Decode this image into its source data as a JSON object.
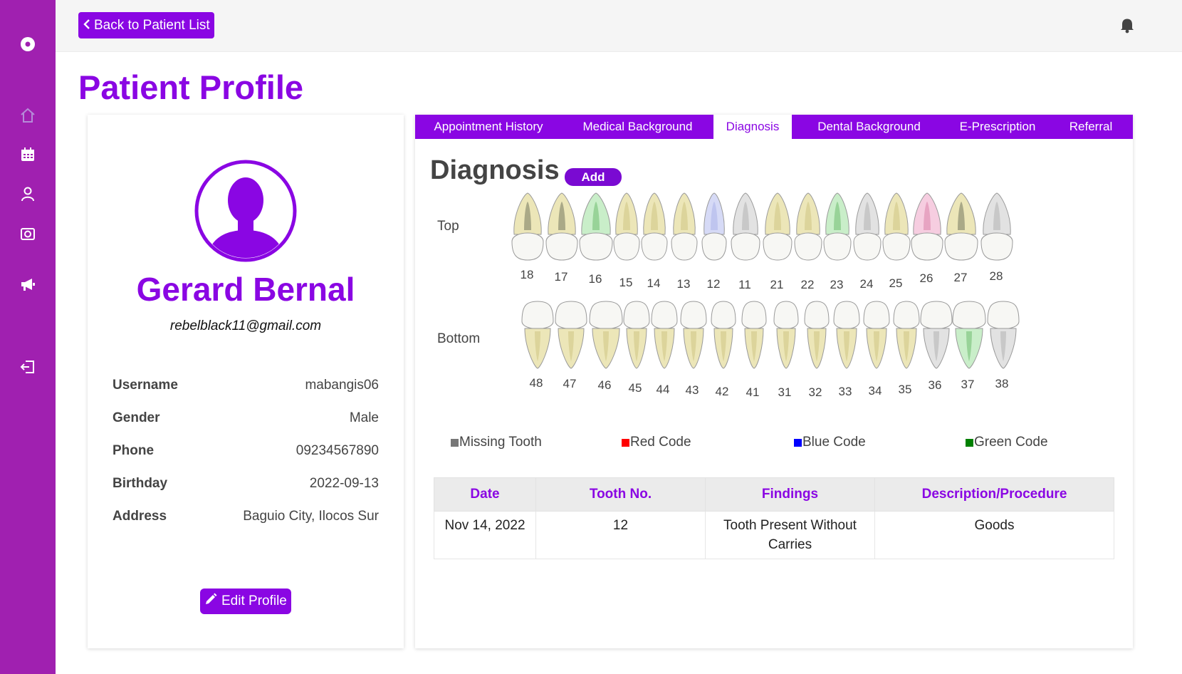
{
  "sidebar": {
    "items": [
      {
        "icon": "logo-icon"
      },
      {
        "icon": "home-icon"
      },
      {
        "icon": "calendar-icon"
      },
      {
        "icon": "user-icon"
      },
      {
        "icon": "camera-icon"
      },
      {
        "icon": "megaphone-icon"
      },
      {
        "icon": "logout-icon"
      }
    ]
  },
  "header": {
    "back_label": "Back to Patient List",
    "bell_icon": "bell-icon"
  },
  "page": {
    "title": "Patient Profile"
  },
  "profile": {
    "name": "Gerard Bernal",
    "email": "rebelblack11@gmail.com",
    "fields": [
      {
        "label": "Username",
        "value": "mabangis06"
      },
      {
        "label": "Gender",
        "value": "Male"
      },
      {
        "label": "Phone",
        "value": "09234567890"
      },
      {
        "label": "Birthday",
        "value": "2022-09-13"
      },
      {
        "label": "Address",
        "value": "Baguio City, Ilocos Sur"
      }
    ],
    "edit_label": "Edit Profile"
  },
  "tabs": [
    {
      "label": "Appointment History",
      "active": false
    },
    {
      "label": "Medical Background",
      "active": false
    },
    {
      "label": "Diagnosis",
      "active": true
    },
    {
      "label": "Dental Background",
      "active": false
    },
    {
      "label": "E-Prescription",
      "active": false
    },
    {
      "label": "Referral",
      "active": false
    }
  ],
  "diagnosis": {
    "title": "Diagnosis",
    "add_label": "Add",
    "top_label": "Top",
    "bottom_label": "Bottom",
    "top_teeth": [
      {
        "no": "18",
        "status": "caries"
      },
      {
        "no": "17",
        "status": "caries"
      },
      {
        "no": "16",
        "status": "green"
      },
      {
        "no": "15",
        "status": "present"
      },
      {
        "no": "14",
        "status": "present"
      },
      {
        "no": "13",
        "status": "present"
      },
      {
        "no": "12",
        "status": "blue"
      },
      {
        "no": "11",
        "status": "missing"
      },
      {
        "no": "21",
        "status": "present"
      },
      {
        "no": "22",
        "status": "present"
      },
      {
        "no": "23",
        "status": "green"
      },
      {
        "no": "24",
        "status": "missing"
      },
      {
        "no": "25",
        "status": "present"
      },
      {
        "no": "26",
        "status": "red"
      },
      {
        "no": "27",
        "status": "caries"
      },
      {
        "no": "28",
        "status": "missing"
      }
    ],
    "bottom_teeth": [
      {
        "no": "48",
        "status": "present"
      },
      {
        "no": "47",
        "status": "present"
      },
      {
        "no": "46",
        "status": "present"
      },
      {
        "no": "45",
        "status": "present"
      },
      {
        "no": "44",
        "status": "present"
      },
      {
        "no": "43",
        "status": "present"
      },
      {
        "no": "42",
        "status": "present"
      },
      {
        "no": "41",
        "status": "present"
      },
      {
        "no": "31",
        "status": "present"
      },
      {
        "no": "32",
        "status": "present"
      },
      {
        "no": "33",
        "status": "present"
      },
      {
        "no": "34",
        "status": "present"
      },
      {
        "no": "35",
        "status": "present"
      },
      {
        "no": "36",
        "status": "missing"
      },
      {
        "no": "37",
        "status": "green"
      },
      {
        "no": "38",
        "status": "missing"
      }
    ],
    "legend": [
      {
        "label": "Missing Tooth",
        "color": "#777777"
      },
      {
        "label": "Red Code",
        "color": "#ff0000"
      },
      {
        "label": "Blue Code",
        "color": "#0000ff"
      },
      {
        "label": "Green Code",
        "color": "#008000"
      }
    ],
    "table": {
      "headers": [
        "Date",
        "Tooth No.",
        "Findings",
        "Description/Procedure"
      ],
      "rows": [
        [
          "Nov 14, 2022",
          "12",
          "Tooth Present Without Carries",
          "Goods"
        ]
      ]
    }
  },
  "colors": {
    "brand": "#8a06e3",
    "sidebar": "#a020b0"
  }
}
